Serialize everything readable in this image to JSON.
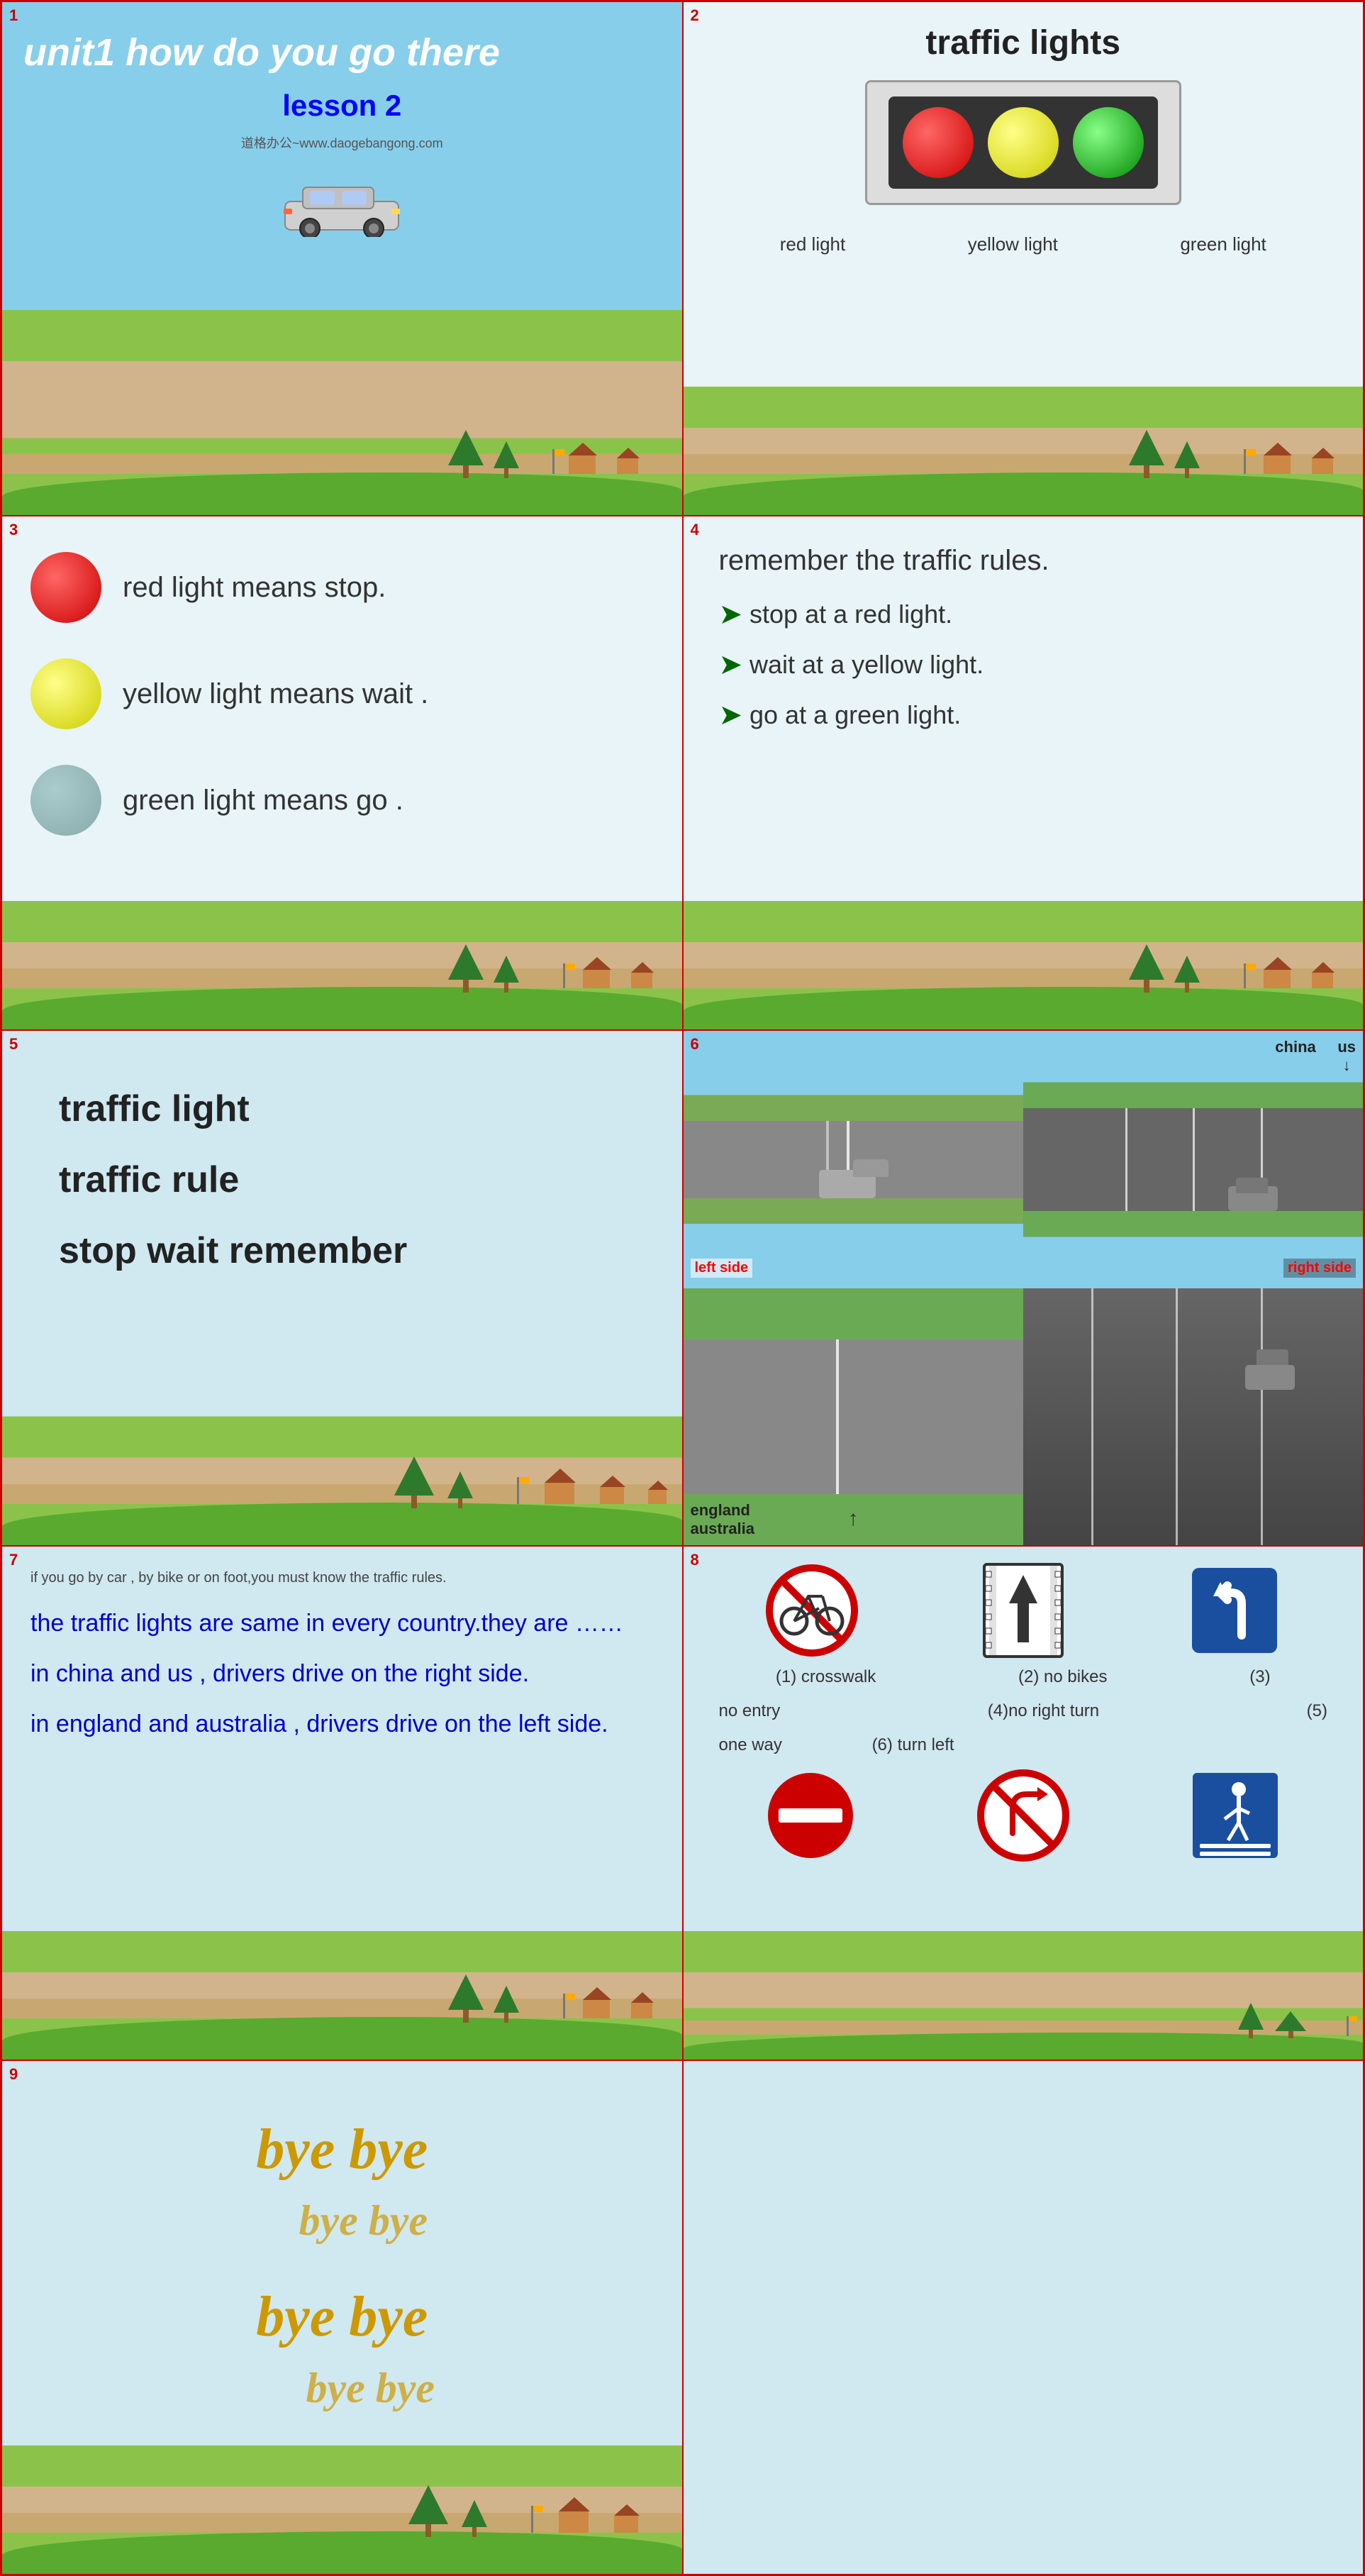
{
  "slides": [
    {
      "num": "1",
      "title": "unit1 how do you go there",
      "lesson": "lesson 2",
      "watermark": "道格办公~www.daogebangong.com"
    },
    {
      "num": "2",
      "title": "traffic  lights",
      "labels": [
        "red light",
        "yellow light",
        "green light"
      ]
    },
    {
      "num": "3",
      "items": [
        "red light means stop.",
        "yellow light means wait .",
        "green light means go ."
      ]
    },
    {
      "num": "4",
      "title": "remember the traffic rules.",
      "rules": [
        "stop at a red light.",
        "wait at a yellow light.",
        "go at a green light."
      ]
    },
    {
      "num": "5",
      "words": [
        "traffic light",
        "traffic rule",
        "stop    wait    remember"
      ]
    },
    {
      "num": "6",
      "china_us": "china      us",
      "eng_aus": "england\naustralia",
      "left_label": "left side",
      "right_label": "right  side"
    },
    {
      "num": "7",
      "note": "if you go by car , by bike or on foot,you must know the traffic rules.",
      "paragraphs": [
        "the traffic lights are same in every country.they are ……",
        "in china and us , drivers drive on the right side.",
        "in england and australia , drivers drive on the left side."
      ]
    },
    {
      "num": "8",
      "signs": [
        {
          "label": "(1)  crosswalk",
          "type": "crosswalk"
        },
        {
          "label": "(2)  no bikes",
          "type": "no-bike"
        },
        {
          "label": "(3)",
          "type": "turn-left"
        },
        {
          "label": "no entry",
          "type": "no-entry"
        },
        {
          "label": "(4)no right turn",
          "type": "no-right"
        },
        {
          "label": "(5)",
          "type": ""
        },
        {
          "label": "one way",
          "type": "one-way"
        },
        {
          "label": "(6)  turn left",
          "type": ""
        }
      ]
    },
    {
      "num": "9",
      "bye_rows": [
        "bye  bye",
        "bye  bye",
        "bye  bye",
        "bye  bye"
      ]
    }
  ]
}
